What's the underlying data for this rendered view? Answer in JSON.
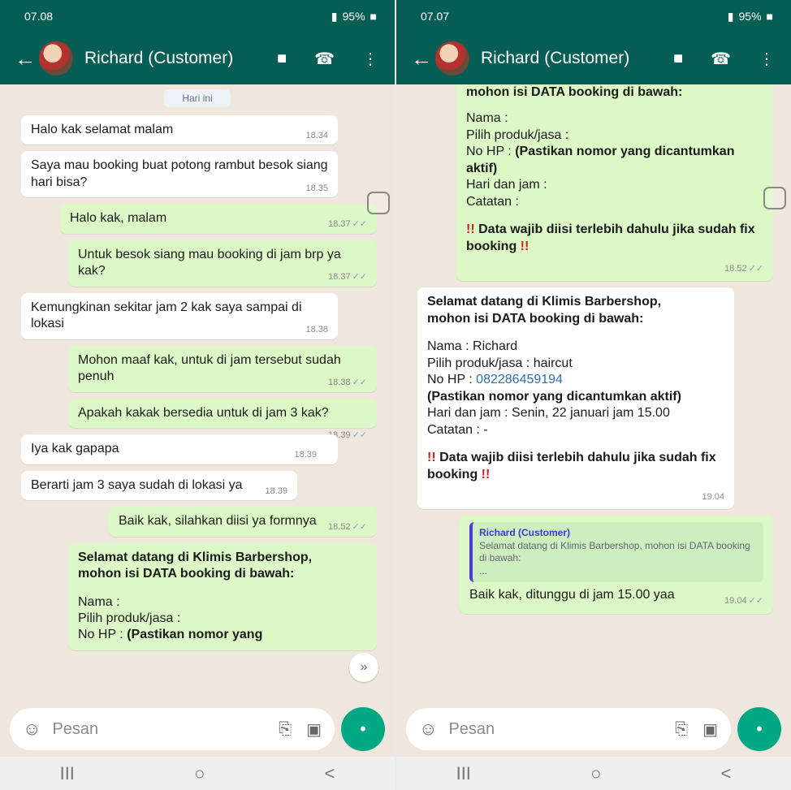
{
  "left": {
    "status": {
      "time": "07.08",
      "signal_text": "95%"
    },
    "header": {
      "contact": "Richard (Customer)"
    },
    "date_chip": "Hari ini",
    "messages": [
      {
        "dir": "in",
        "text": "Halo kak selamat malam",
        "time": "18.34"
      },
      {
        "dir": "in",
        "text": "Saya mau booking buat potong rambut besok siang hari bisa?",
        "time": "18.35"
      },
      {
        "dir": "out",
        "text": "Halo kak, malam",
        "time": "18.37"
      },
      {
        "dir": "out",
        "text": "Untuk besok siang mau booking di jam brp ya kak?",
        "time": "18.37"
      },
      {
        "dir": "in",
        "text": "Kemungkinan sekitar jam 2 kak saya sampai di lokasi",
        "time": "18.38"
      },
      {
        "dir": "out",
        "text": "Mohon maaf kak, untuk di jam tersebut sudah penuh",
        "time": "18.38"
      },
      {
        "dir": "out",
        "text": "Apakah kakak bersedia untuk di jam 3 kak?",
        "time": "18.39"
      },
      {
        "dir": "in",
        "text": "Iya kak gapapa",
        "time": "18.39"
      },
      {
        "dir": "in",
        "text": "Berarti jam 3 saya sudah di lokasi ya",
        "time": "18.39"
      },
      {
        "dir": "out",
        "text": "Baik kak, silahkan diisi ya formnya",
        "time": "18.52"
      }
    ],
    "form_preview": {
      "title_line1": "Selamat datang di Klimis Barbershop,",
      "title_line2": "mohon isi DATA booking di bawah:",
      "nama": "Nama :",
      "produk": "Pilih produk/jasa :",
      "nohp": "No HP :",
      "nohp_note": "(Pastikan nomor yang"
    },
    "input": {
      "placeholder": "Pesan"
    },
    "scroll_icon": "»"
  },
  "right": {
    "status": {
      "time": "07.07",
      "signal_text": "95%"
    },
    "header": {
      "contact": "Richard (Customer)"
    },
    "form_template": {
      "top_cut": "mohon isi DATA booking di bawah:",
      "nama": "Nama :",
      "produk": "Pilih produk/jasa :",
      "nohp": "No HP :",
      "nohp_note": "(Pastikan nomor yang dicantumkan aktif)",
      "hari": "Hari dan jam :",
      "catatan": "Catatan :",
      "warning": "Data wajib diisi terlebih dahulu jika sudah fix booking",
      "time": "18.52"
    },
    "form_filled": {
      "title_line1": "Selamat datang di Klimis Barbershop,",
      "title_line2": "mohon isi DATA booking di bawah:",
      "nama": "Nama : Richard",
      "produk": "Pilih produk/jasa : haircut",
      "nohp_label": "No HP : ",
      "nohp_value": "082286459194",
      "nohp_note": "(Pastikan nomor yang dicantumkan aktif)",
      "hari": "Hari dan jam : Senin, 22 januari jam 15.00",
      "catatan": "Catatan : -",
      "warning": "Data wajib diisi terlebih dahulu jika sudah fix booking",
      "time": "19.04"
    },
    "reply": {
      "quote_name": "Richard (Customer)",
      "quote_text": "Selamat datang di Klimis Barbershop, mohon isi DATA booking di bawah:",
      "quote_more": "...",
      "text": "Baik kak, ditunggu di jam 15.00 yaa",
      "time": "19.04"
    },
    "input": {
      "placeholder": "Pesan"
    }
  },
  "icons": {
    "back": "←",
    "video": "■",
    "phone": "☎",
    "more": "⋮",
    "emoji": "☺",
    "attach": "⎘",
    "camera": "▣",
    "mic": "•",
    "nav_recents": "III",
    "nav_home": "○",
    "nav_back": "<"
  }
}
